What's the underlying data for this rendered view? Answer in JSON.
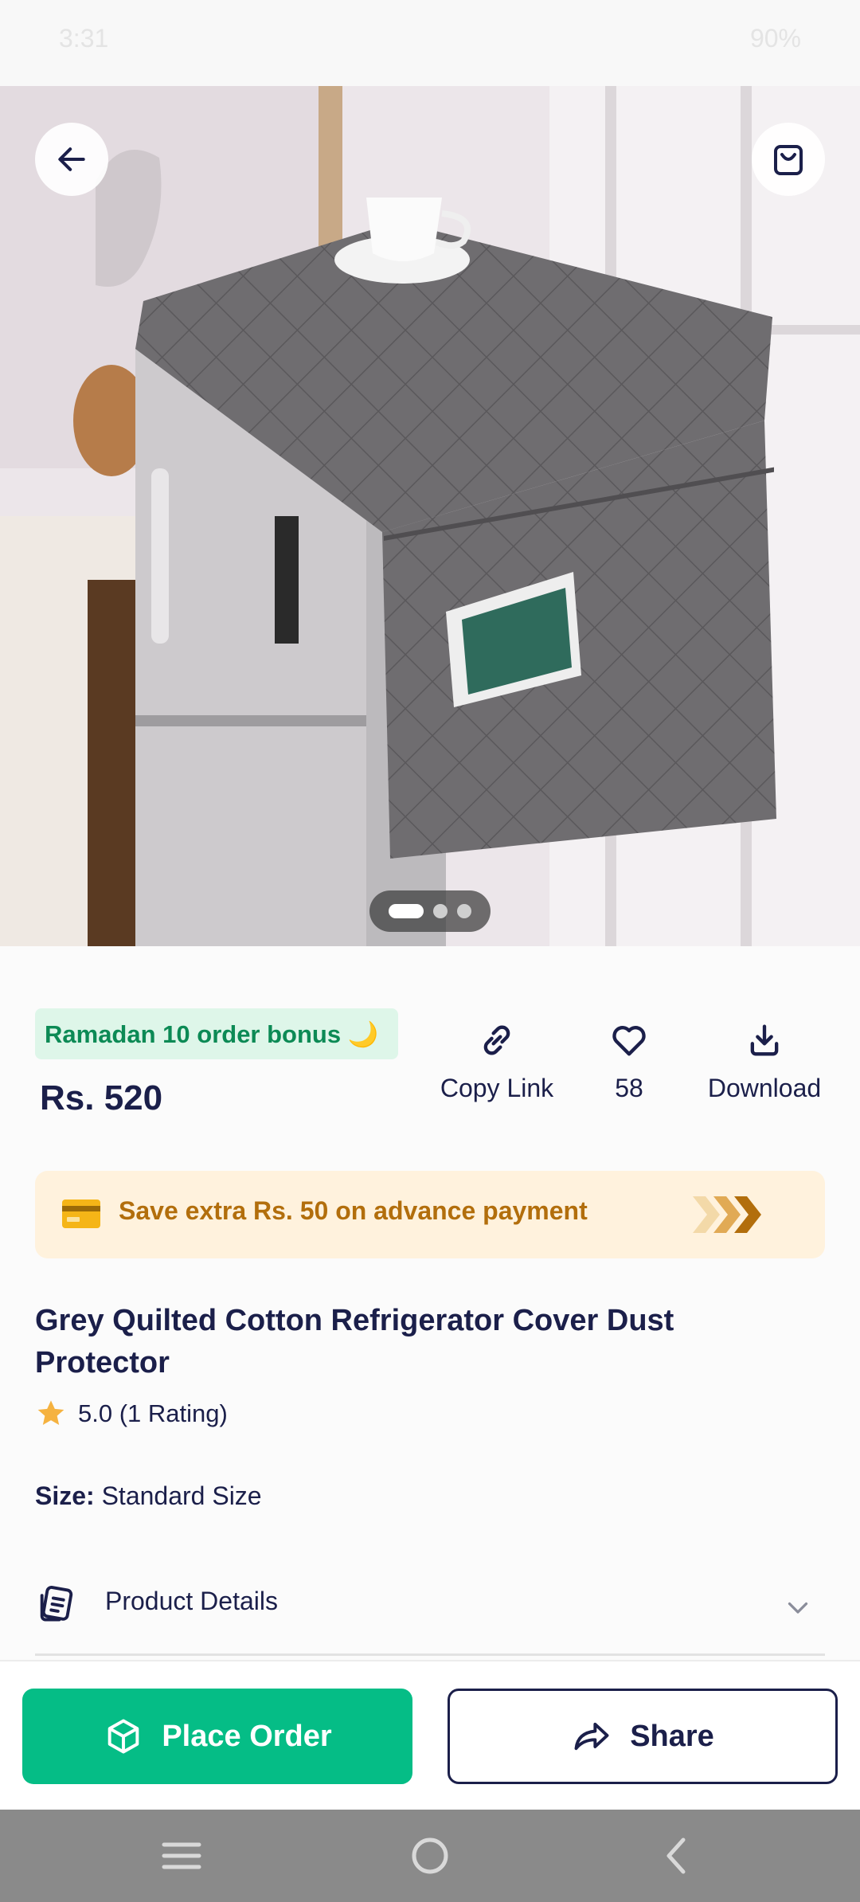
{
  "status_bar": {
    "time": "3:31",
    "battery": "90%"
  },
  "hero": {
    "image_label": "Grey quilted refrigerator cover product photo",
    "dots_count": 3,
    "active_dot": 0
  },
  "bonus_badge": "Ramadan 10 order bonus 🌙",
  "price": "Rs. 520",
  "actions": [
    {
      "label": "Copy Link",
      "icon": "link-icon"
    },
    {
      "label": "58",
      "icon": "heart-icon"
    },
    {
      "label": "Download",
      "icon": "download-icon"
    }
  ],
  "promo": {
    "text": "Save extra Rs. 50 on advance payment",
    "icon": "card-icon"
  },
  "product": {
    "title": "Grey Quilted Cotton Refrigerator Cover Dust Protector",
    "rating_text": "5.0 (1 Rating)",
    "size_label": "Size:",
    "size_value": "Standard Size"
  },
  "details": {
    "label": "Product Details"
  },
  "buttons": {
    "place_order": "Place Order",
    "share": "Share"
  },
  "colors": {
    "primary_green": "#05bd86",
    "navy": "#1b1f4a",
    "promo_bg": "#fff2dd",
    "promo_text": "#b26e0c",
    "badge_bg": "#def6e9"
  }
}
